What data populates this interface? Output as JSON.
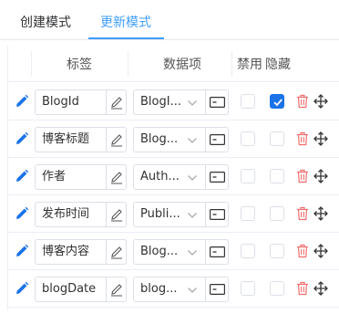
{
  "tabs": [
    {
      "label": "创建模式",
      "active": false
    },
    {
      "label": "更新模式",
      "active": true
    }
  ],
  "table": {
    "headers": {
      "label": "标签",
      "data_item": "数据项",
      "disabled": "禁用",
      "hidden": "隐藏"
    },
    "rows": [
      {
        "label": "BlogId",
        "data_item": "BlogI...",
        "disabled": false,
        "hidden": true
      },
      {
        "label": "博客标题",
        "data_item": "Blog...",
        "disabled": false,
        "hidden": false
      },
      {
        "label": "作者",
        "data_item": "Auth...",
        "disabled": false,
        "hidden": false
      },
      {
        "label": "发布时间",
        "data_item": "Publi...",
        "disabled": false,
        "hidden": false
      },
      {
        "label": "博客内容",
        "data_item": "Blog...",
        "disabled": false,
        "hidden": false
      },
      {
        "label": "blogDate",
        "data_item": "blog...",
        "disabled": false,
        "hidden": false
      }
    ]
  },
  "icons": {
    "edit": "pencil-icon",
    "label_edit": "pen-outline-icon",
    "dropdown": "chevron-down-icon",
    "input_type": "input-box-icon",
    "delete": "trash-icon",
    "drag": "move-arrows-icon"
  },
  "colors": {
    "accent": "#409eff",
    "checkbox_checked": "#1a73e8",
    "edit_icon": "#1a73e8",
    "delete_icon": "#f56c6c"
  }
}
